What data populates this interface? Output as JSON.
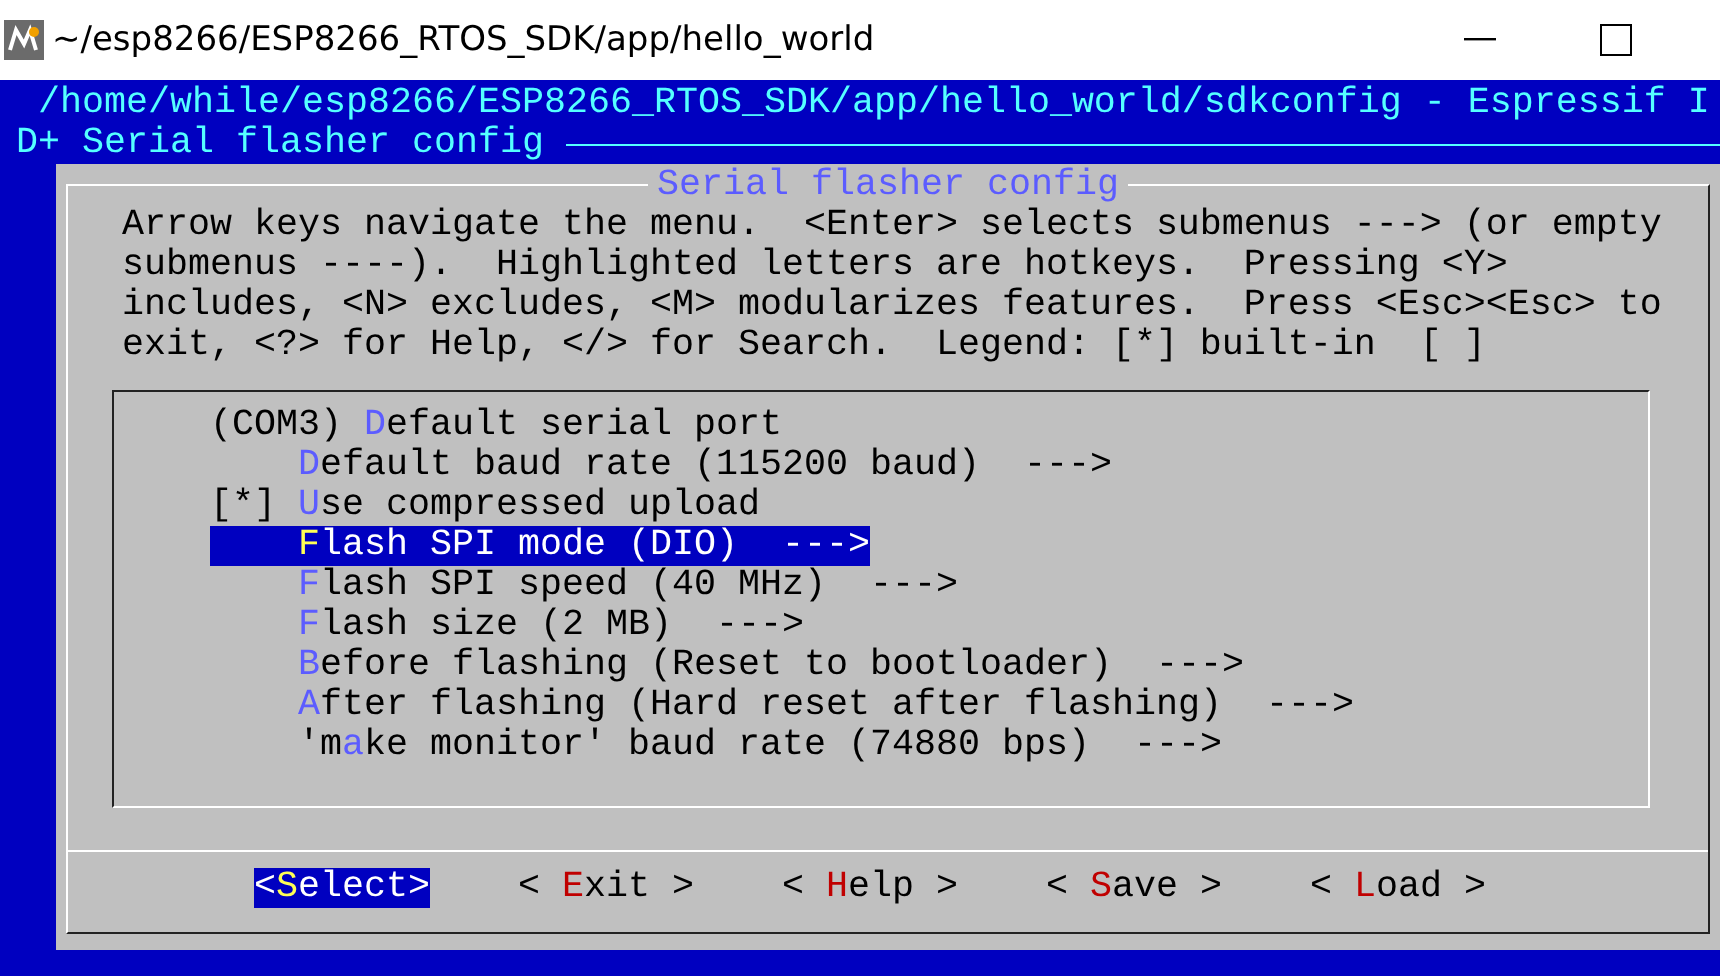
{
  "window": {
    "title": "~/esp8266/ESP8266_RTOS_SDK/app/hello_world"
  },
  "terminal": {
    "path_line": "/home/while/esp8266/ESP8266_RTOS_SDK/app/hello_world/sdkconfig - Espressif I",
    "breadcrumb": "D+ Serial flasher config"
  },
  "dialog": {
    "title": "Serial flasher config",
    "help_lines": [
      "Arrow keys navigate the menu.  <Enter> selects submenus ---> (or empty",
      "submenus ----).  Highlighted letters are hotkeys.  Pressing <Y>",
      "includes, <N> excludes, <M> modularizes features.  Press <Esc><Esc> to",
      "exit, <?> for Help, </> for Search.  Legend: [*] built-in  [ ]"
    ],
    "items": [
      {
        "indented": false,
        "before": "(COM3) ",
        "hotkey": "D",
        "after": "efault serial port",
        "selected": false
      },
      {
        "indented": true,
        "hotkey": "D",
        "after": "efault baud rate (115200 baud)  --->",
        "selected": false
      },
      {
        "indented": false,
        "before": "[*] ",
        "hotkey": "U",
        "after": "se compressed upload",
        "selected": false
      },
      {
        "indented": true,
        "hotkey": "F",
        "after": "lash SPI mode (DIO)  --->",
        "selected": true
      },
      {
        "indented": true,
        "hotkey": "F",
        "after": "lash SPI speed (40 MHz)  --->",
        "selected": false
      },
      {
        "indented": true,
        "hotkey": "F",
        "after": "lash size (2 MB)  --->",
        "selected": false
      },
      {
        "indented": true,
        "hotkey": "B",
        "after": "efore flashing (Reset to bootloader)  --->",
        "selected": false
      },
      {
        "indented": true,
        "hotkey": "A",
        "after": "fter flashing (Hard reset after flashing)  --->",
        "selected": false
      },
      {
        "indented": true,
        "before": "'m",
        "hotkey": "a",
        "after": "ke monitor' baud rate (74880 bps)  --->",
        "selected": false
      }
    ],
    "buttons": [
      {
        "before": "<",
        "hotkey": "S",
        "after": "elect>",
        "selected": true
      },
      {
        "before": "< ",
        "hotkey": "E",
        "after": "xit >",
        "selected": false
      },
      {
        "before": "< ",
        "hotkey": "H",
        "after": "elp >",
        "selected": false
      },
      {
        "before": "< ",
        "hotkey": "S",
        "after": "ave >",
        "selected": false
      },
      {
        "before": "< ",
        "hotkey": "L",
        "after": "oad >",
        "selected": false
      }
    ]
  }
}
